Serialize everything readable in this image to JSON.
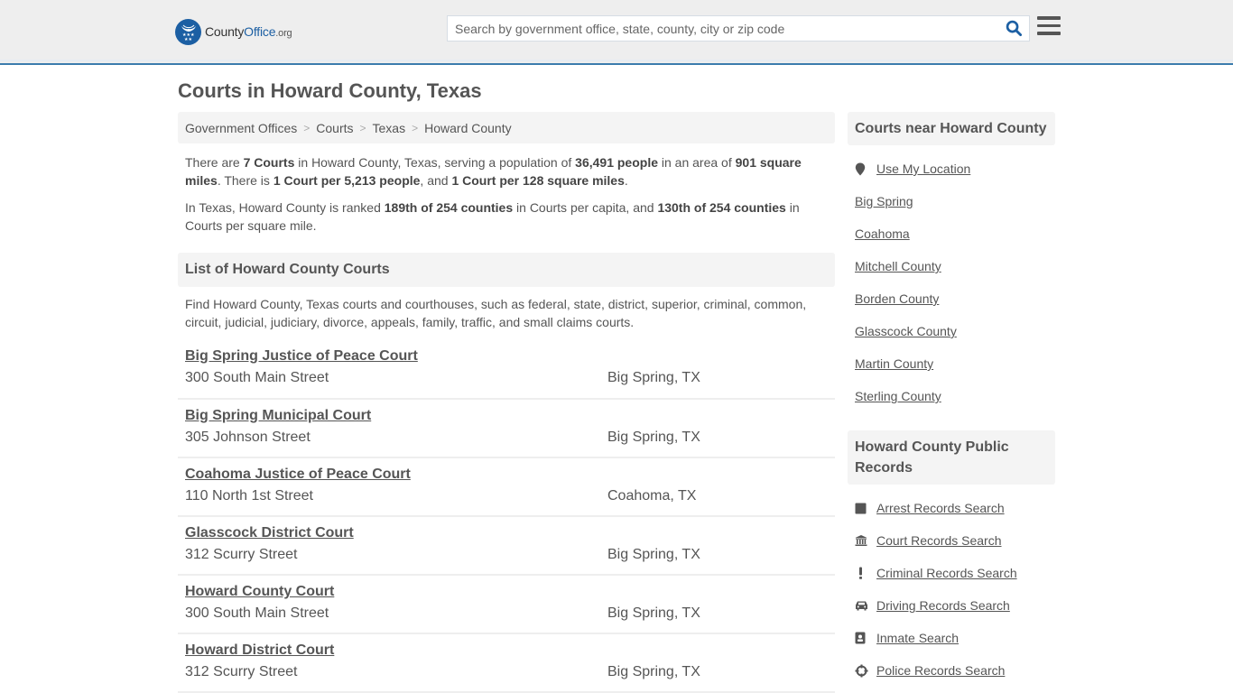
{
  "header": {
    "logo": {
      "prefix": "County",
      "brand": "Office",
      "suffix": ".org"
    },
    "search": {
      "placeholder": "Search by government office, state, county, city or zip code",
      "value": ""
    }
  },
  "page": {
    "title": "Courts in Howard County, Texas"
  },
  "breadcrumb": [
    "Government Offices",
    "Courts",
    "Texas",
    "Howard County"
  ],
  "intro": {
    "p1": [
      "There are ",
      "7 Courts",
      " in Howard County, Texas, serving a population of ",
      "36,491 people",
      " in an area of ",
      "901 square miles",
      ". There is ",
      "1 Court per 5,213 people",
      ", and ",
      "1 Court per 128 square miles",
      "."
    ],
    "p2": [
      "In Texas, Howard County is ranked ",
      "189th of 254 counties",
      " in Courts per capita, and ",
      "130th of 254 counties",
      " in Courts per square mile."
    ]
  },
  "list": {
    "heading": "List of Howard County Courts",
    "description": "Find Howard County, Texas courts and courthouses, such as federal, state, district, superior, criminal, common, circuit, judicial, judiciary, divorce, appeals, family, traffic, and small claims courts.",
    "courts": [
      {
        "name": "Big Spring Justice of Peace Court",
        "address": "300 South Main Street",
        "city": "Big Spring, TX"
      },
      {
        "name": "Big Spring Municipal Court",
        "address": "305 Johnson Street",
        "city": "Big Spring, TX"
      },
      {
        "name": "Coahoma Justice of Peace Court",
        "address": "110 North 1st Street",
        "city": "Coahoma, TX"
      },
      {
        "name": "Glasscock District Court",
        "address": "312 Scurry Street",
        "city": "Big Spring, TX"
      },
      {
        "name": "Howard County Court",
        "address": "300 South Main Street",
        "city": "Big Spring, TX"
      },
      {
        "name": "Howard District Court",
        "address": "312 Scurry Street",
        "city": "Big Spring, TX"
      }
    ]
  },
  "sidebar": {
    "nearby": {
      "heading": "Courts near Howard County",
      "use_location": "Use My Location",
      "links": [
        "Big Spring",
        "Coahoma",
        "Mitchell County",
        "Borden County",
        "Glasscock County",
        "Martin County",
        "Sterling County"
      ]
    },
    "records": {
      "heading": "Howard County Public Records",
      "links": [
        {
          "label": "Arrest Records Search",
          "icon": "square-icon"
        },
        {
          "label": "Court Records Search",
          "icon": "courthouse-icon"
        },
        {
          "label": "Criminal Records Search",
          "icon": "exclamation-icon"
        },
        {
          "label": "Driving Records Search",
          "icon": "car-icon"
        },
        {
          "label": "Inmate Search",
          "icon": "id-badge-icon"
        },
        {
          "label": "Police Records Search",
          "icon": "crosshairs-icon"
        }
      ]
    }
  },
  "colors": {
    "brand": "#1c5fa3",
    "header_rule": "#3b7cad",
    "text": "#555555",
    "panel": "#f4f4f4"
  }
}
